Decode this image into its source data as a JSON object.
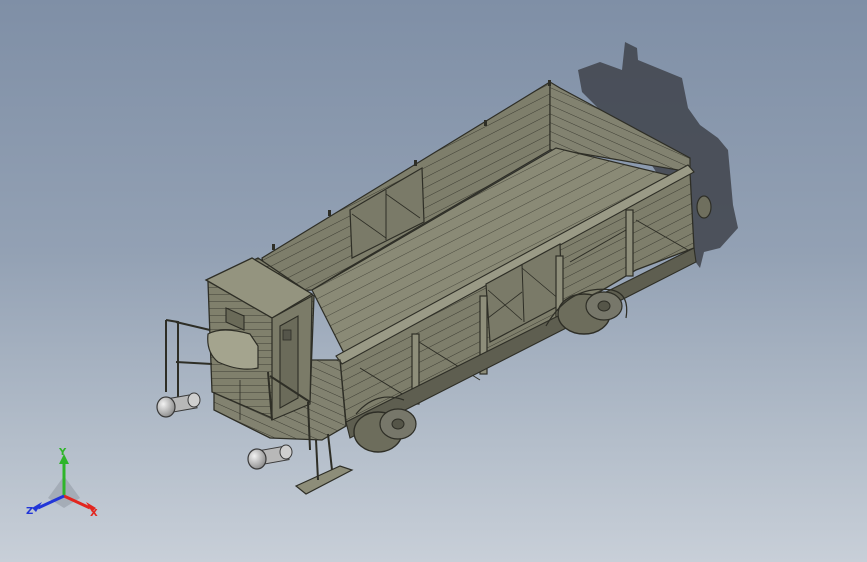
{
  "viewport": {
    "model": "open-freight-wagon-with-brake-cabin",
    "background_top": "#7f8fa6",
    "background_bottom": "#c8cfd8",
    "body_color": "#848470",
    "edge_color": "#2e2e26",
    "shadow_color": "#3f434b"
  },
  "triad": {
    "x_label": "X",
    "y_label": "Y",
    "z_label": "Z",
    "x_color": "#e2261f",
    "y_color": "#2fb52a",
    "z_color": "#2236d8"
  }
}
